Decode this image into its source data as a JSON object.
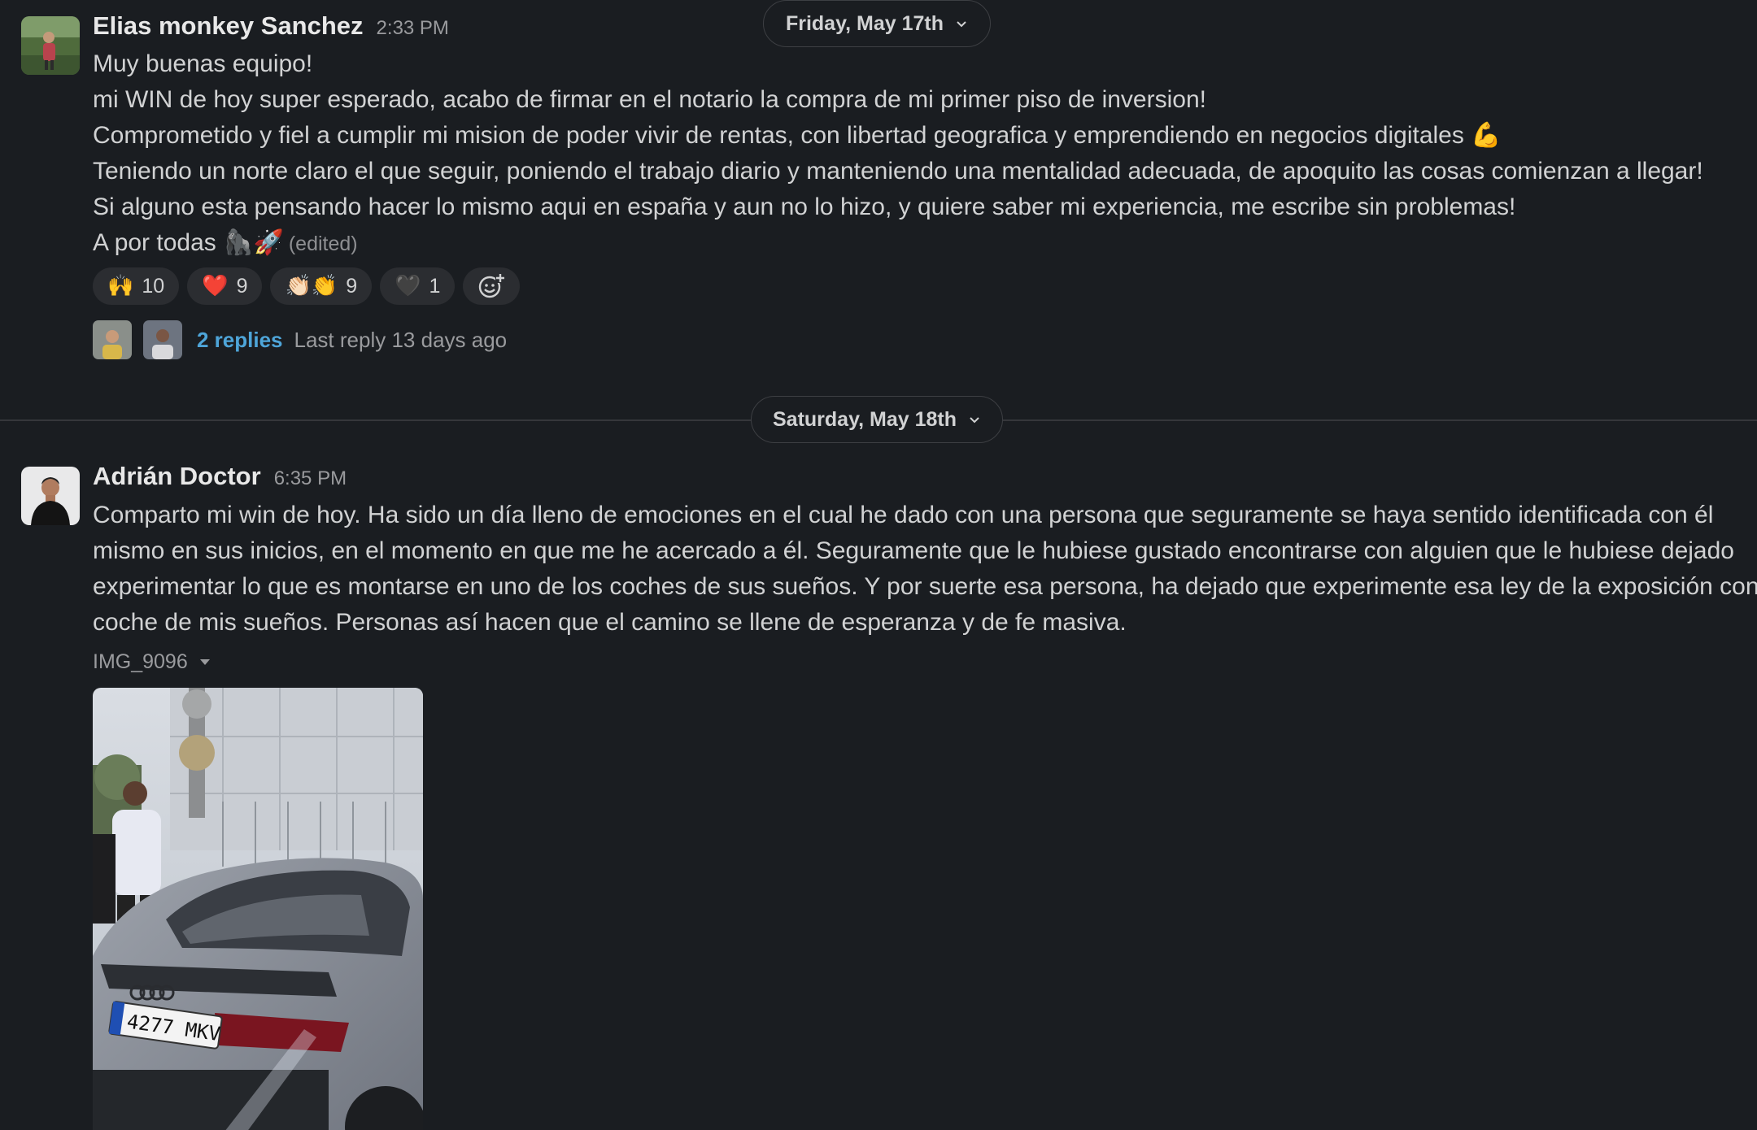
{
  "days": [
    {
      "label": "Friday, May 17th"
    },
    {
      "label": "Saturday, May 18th"
    }
  ],
  "messages": [
    {
      "sender": "Elias monkey Sanchez",
      "time": "2:33 PM",
      "lines": [
        "Muy buenas equipo!",
        "mi WIN de hoy super esperado, acabo de firmar en el notario la compra de mi primer piso de inversion!",
        "Comprometido y fiel a cumplir mi mision de poder vivir de rentas, con libertad geografica y emprendiendo en negocios digitales",
        "Teniendo un norte claro el que seguir, poniendo el trabajo diario y manteniendo una mentalidad adecuada, de apoquito las cosas comienzan a llegar!",
        "Si alguno esta pensando hacer lo mismo aqui en españa y aun no lo hizo, y quiere saber mi experiencia, me escribe sin problemas!",
        "A por todas"
      ],
      "line3_emoji": "💪",
      "last_line_emoji": "🦍🚀",
      "edited": "(edited)",
      "reactions": [
        {
          "emoji": "🙌",
          "count": "10"
        },
        {
          "emoji": "❤️",
          "count": "9"
        },
        {
          "emoji": "👏🏻👏",
          "count": "9"
        },
        {
          "emoji": "🖤",
          "count": "1"
        }
      ],
      "add_reaction_icon": "add-emoji-icon",
      "replies": "2 replies",
      "last_reply": "Last reply 13 days ago"
    },
    {
      "sender": "Adrián Doctor",
      "time": "6:35 PM",
      "lines": [
        "Comparto mi win de hoy. Ha sido un día lleno de emociones en el cual he dado con una persona que seguramente se haya sentido identificada con él",
        "mismo en sus inicios, en el momento en que me he acercado a él. Seguramente que le hubiese gustado encontrarse con alguien que le hubiese dejado",
        "experimentar lo que es montarse en uno de los coches de sus sueños. Y por suerte esa persona, ha dejado que experimente esa ley de la exposición con el",
        "coche de mis sueños. Personas así hacen que el camino se llene de esperanza y de fe masiva."
      ],
      "file_name": "IMG_9096",
      "plate": "4277 MKV"
    }
  ]
}
